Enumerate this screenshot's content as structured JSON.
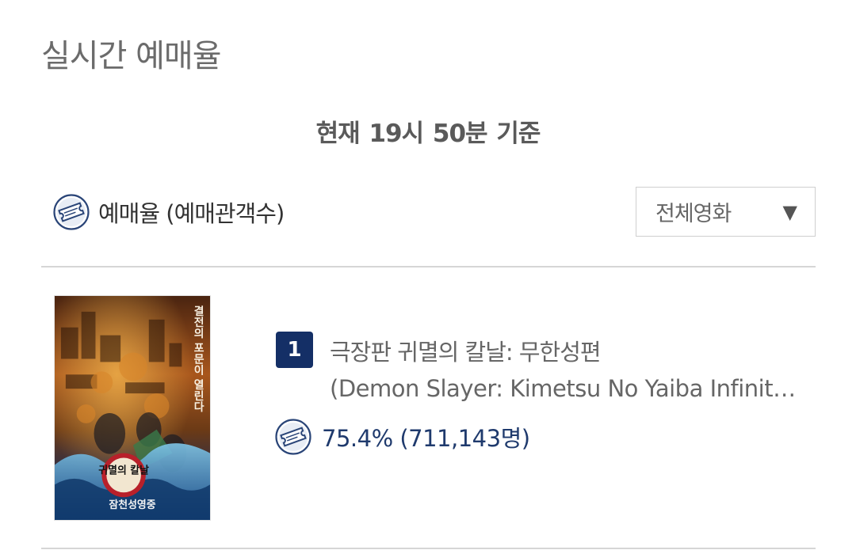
{
  "header": {
    "title": "실시간 예매율",
    "timestamp": "현재  19시 50분   기준"
  },
  "section": {
    "label": "예매율 (예매관객수)",
    "icon": "ticket-icon"
  },
  "filter": {
    "selected": "전체영화",
    "arrow": "▼"
  },
  "movies": [
    {
      "rank": "1",
      "title": "극장판 귀멸의 칼날: 무한성편",
      "subtitle": "(Demon Slayer: Kimetsu No Yaiba Infinity Castle)",
      "rate": "75.4% (711,143명)",
      "poster": {
        "caption_vertical": "결전의 포문이 열린다",
        "logo_text": "귀멸의 칼날",
        "bottom_text": "잠천성영중"
      }
    }
  ],
  "colors": {
    "rank_badge": "#142f66",
    "rate_text": "#1f3a6d",
    "icon_stroke": "#2a4578",
    "divider": "#d6d6d6"
  }
}
